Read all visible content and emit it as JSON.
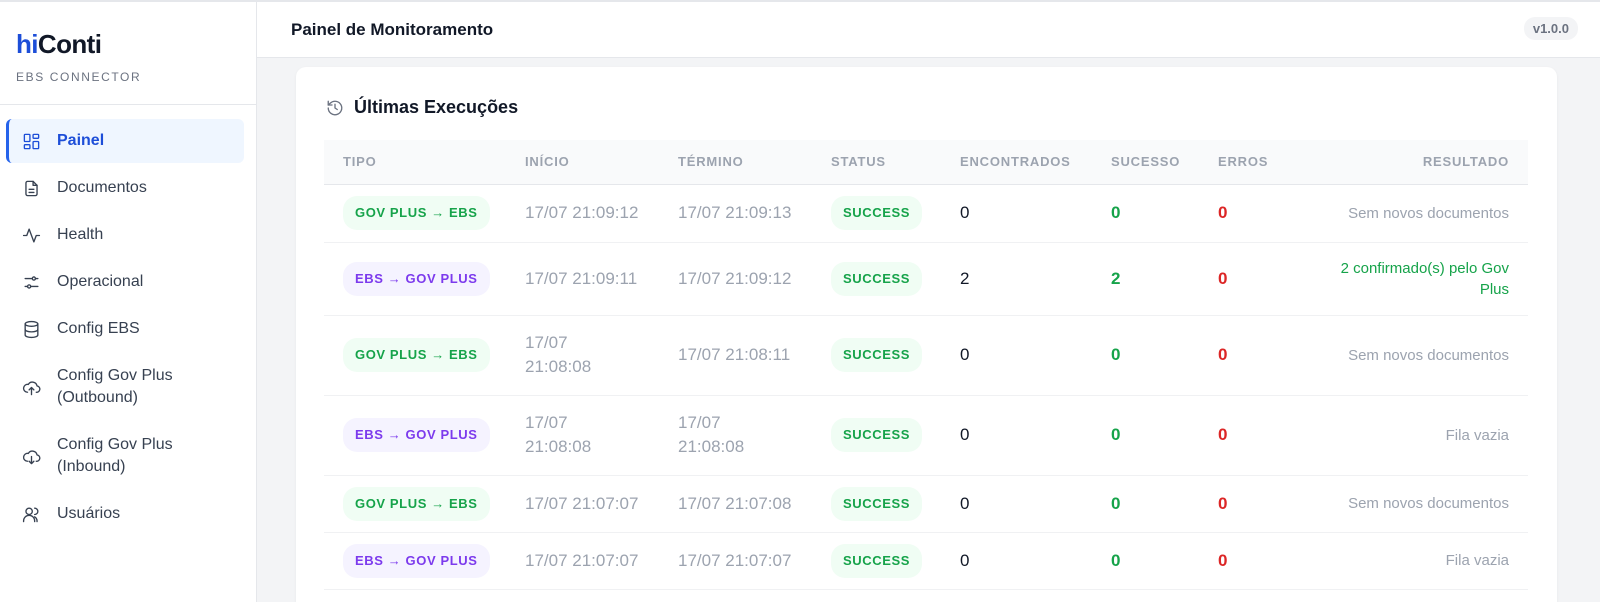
{
  "brand": {
    "logo_hi": "hi",
    "logo_conti": "Conti",
    "tagline": "EBS CONNECTOR"
  },
  "sidebar": {
    "items": [
      {
        "label": "Painel",
        "icon": "dashboard-icon",
        "active": true
      },
      {
        "label": "Documentos",
        "icon": "document-icon"
      },
      {
        "label": "Health",
        "icon": "activity-icon"
      },
      {
        "label": "Operacional",
        "icon": "sliders-icon"
      },
      {
        "label": "Config EBS",
        "icon": "database-icon"
      },
      {
        "label": "Config Gov Plus (Outbound)",
        "icon": "cloud-upload-icon"
      },
      {
        "label": "Config Gov Plus (Inbound)",
        "icon": "cloud-download-icon"
      },
      {
        "label": "Usuários",
        "icon": "users-icon"
      }
    ]
  },
  "header": {
    "title": "Painel de Monitoramento",
    "version": "v1.0.0"
  },
  "card": {
    "title": "Últimas Execuções",
    "icon": "history-icon",
    "columns": [
      "TIPO",
      "INÍCIO",
      "TÉRMINO",
      "STATUS",
      "ENCONTRADOS",
      "SUCESSO",
      "ERROS",
      "RESULTADO"
    ],
    "rows": [
      {
        "tipo": "GOV PLUS → EBS",
        "inicio": "17/07 21:09:12",
        "termino": "17/07 21:09:13",
        "status": "SUCCESS",
        "encontrados": "0",
        "sucesso": "0",
        "erros": "0",
        "resultado": "Sem novos documentos"
      },
      {
        "tipo": "EBS → GOV PLUS",
        "inicio": "17/07 21:09:11",
        "termino": "17/07 21:09:12",
        "status": "SUCCESS",
        "encontrados": "2",
        "sucesso": "2",
        "erros": "0",
        "resultado": "2 confirmado(s) pelo Gov Plus"
      },
      {
        "tipo": "GOV PLUS → EBS",
        "inicio": "17/07 21:08:08",
        "termino": "17/07 21:08:11",
        "status": "SUCCESS",
        "encontrados": "0",
        "sucesso": "0",
        "erros": "0",
        "resultado": "Sem novos documentos"
      },
      {
        "tipo": "EBS → GOV PLUS",
        "inicio": "17/07 21:08:08",
        "termino": "17/07 21:08:08",
        "status": "SUCCESS",
        "encontrados": "0",
        "sucesso": "0",
        "erros": "0",
        "resultado": "Fila vazia"
      },
      {
        "tipo": "GOV PLUS → EBS",
        "inicio": "17/07 21:07:07",
        "termino": "17/07 21:07:08",
        "status": "SUCCESS",
        "encontrados": "0",
        "sucesso": "0",
        "erros": "0",
        "resultado": "Sem novos documentos"
      },
      {
        "tipo": "EBS → GOV PLUS",
        "inicio": "17/07 21:07:07",
        "termino": "17/07 21:07:07",
        "status": "SUCCESS",
        "encontrados": "0",
        "sucesso": "0",
        "erros": "0",
        "resultado": "Fila vazia"
      }
    ]
  },
  "colors": {
    "accent": "#2563eb",
    "success": "#16a34a",
    "error": "#dc2626",
    "ebs_purple": "#7c3aed"
  }
}
